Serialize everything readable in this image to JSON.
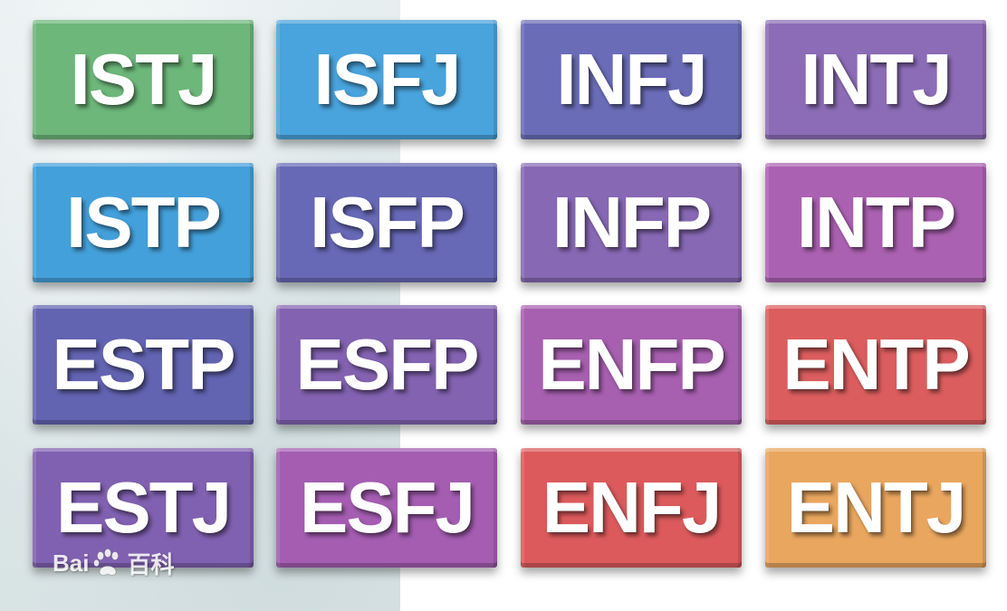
{
  "tiles": [
    {
      "label": "ISTJ",
      "color": "#6db77a"
    },
    {
      "label": "ISFJ",
      "color": "#49a3dc"
    },
    {
      "label": "INFJ",
      "color": "#6a6cb8"
    },
    {
      "label": "INTJ",
      "color": "#8c6cb6"
    },
    {
      "label": "ISTP",
      "color": "#44a0da"
    },
    {
      "label": "ISFP",
      "color": "#6768b6"
    },
    {
      "label": "INFP",
      "color": "#8768b4"
    },
    {
      "label": "INTP",
      "color": "#ab61b1"
    },
    {
      "label": "ESTP",
      "color": "#6263b1"
    },
    {
      "label": "ESFP",
      "color": "#8362b1"
    },
    {
      "label": "ENFP",
      "color": "#a75fb0"
    },
    {
      "label": "ENTP",
      "color": "#db5d5e"
    },
    {
      "label": "ESTJ",
      "color": "#8060b0"
    },
    {
      "label": "ESFJ",
      "color": "#a45db1"
    },
    {
      "label": "ENFJ",
      "color": "#dc5a5c"
    },
    {
      "label": "ENTJ",
      "color": "#e9a65f"
    }
  ],
  "watermark": {
    "text_latin": "Bai",
    "icon": "paw-icon",
    "text_cn": "百科"
  }
}
